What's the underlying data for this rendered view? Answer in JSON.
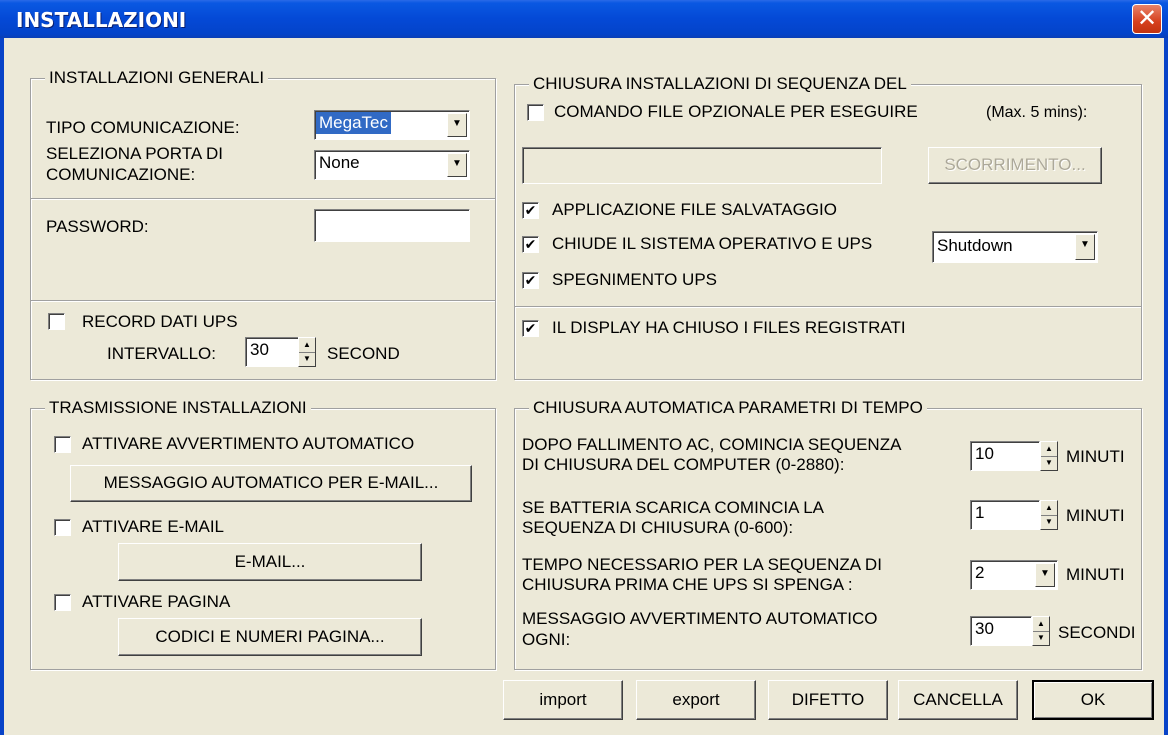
{
  "window": {
    "title": "INSTALLAZIONI",
    "close_glyph": "✕"
  },
  "general": {
    "title": "INSTALLAZIONI GENERALI",
    "comm_type_label": "TIPO COMUNICAZIONE:",
    "comm_type_value": "MegaTec",
    "port_label_line1": "SELEZIONA PORTA DI",
    "port_label_line2": "COMUNICAZIONE:",
    "port_value": "None",
    "password_label": "PASSWORD:",
    "password_value": "",
    "record_label": "RECORD DATI UPS",
    "record_checked": false,
    "interval_label": "INTERVALLO:",
    "interval_value": "30",
    "interval_unit": "SECOND"
  },
  "shutdown_sequence": {
    "title": "CHIUSURA INSTALLAZIONI DI SEQUENZA DEL",
    "cmd_file_label": "COMANDO FILE OPZIONALE PER ESEGUIRE",
    "cmd_file_checked": false,
    "max_note": "(Max. 5 mins):",
    "cmd_file_path": "",
    "browse_label": "SCORRIMENTO...",
    "save_file_label": "APPLICAZIONE FILE SALVATAGGIO",
    "save_file_checked": true,
    "close_os_label": "CHIUDE IL SISTEMA OPERATIVO E UPS",
    "close_os_checked": true,
    "close_os_mode": "Shutdown",
    "ups_off_label": "SPEGNIMENTO UPS",
    "ups_off_checked": true,
    "display_closed_label": "IL DISPLAY HA CHIUSO I FILES REGISTRATI",
    "display_closed_checked": true
  },
  "transmission": {
    "title": "TRASMISSIONE INSTALLAZIONI",
    "auto_warning_label": "ATTIVARE AVVERTIMENTO AUTOMATICO",
    "auto_warning_checked": false,
    "auto_email_button": "MESSAGGIO AUTOMATICO PER E-MAIL...",
    "email_label": "ATTIVARE E-MAIL",
    "email_checked": false,
    "email_button": "E-MAIL...",
    "page_label": "ATTIVARE PAGINA",
    "page_checked": false,
    "page_button": "CODICI E NUMERI PAGINA..."
  },
  "auto_time": {
    "title": "CHIUSURA AUTOMATICA PARAMETRI DI TEMPO",
    "ac_fail_line1": "DOPO FALLIMENTO AC, COMINCIA SEQUENZA",
    "ac_fail_line2": "DI CHIUSURA DEL COMPUTER (0-2880):",
    "ac_fail_value": "10",
    "ac_fail_unit": "MINUTI",
    "low_batt_line1": "SE BATTERIA SCARICA COMINCIA LA",
    "low_batt_line2": "SEQUENZA DI CHIUSURA  (0-600):",
    "low_batt_value": "1",
    "low_batt_unit": "MINUTI",
    "seq_time_line1": "TEMPO NECESSARIO PER LA SEQUENZA DI",
    "seq_time_line2": "CHIUSURA PRIMA CHE UPS SI SPENGA :",
    "seq_time_value": "2",
    "seq_time_unit": "MINUTI",
    "warn_every_line1": "MESSAGGIO AVVERTIMENTO AUTOMATICO",
    "warn_every_line2": "OGNI:",
    "warn_every_value": "30",
    "warn_every_unit": "SECONDI"
  },
  "footer": {
    "import_label": "import",
    "export_label": "export",
    "default_label": "DIFETTO",
    "cancel_label": "CANCELLA",
    "ok_label": "OK"
  },
  "icons": {
    "check_glyph": "✔",
    "dropdown_glyph": "▼",
    "spin_up": "▲",
    "spin_down": "▼"
  }
}
